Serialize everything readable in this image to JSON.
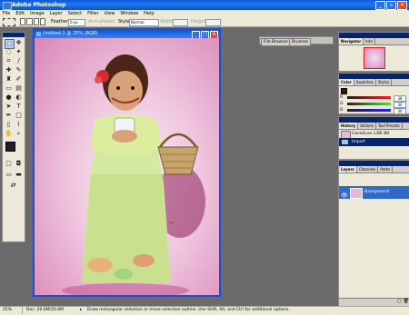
{
  "app": {
    "title": "Adobe Photoshop"
  },
  "menu": [
    "File",
    "Edit",
    "Image",
    "Layer",
    "Select",
    "Filter",
    "View",
    "Window",
    "Help"
  ],
  "options": {
    "feather_label": "Feather:",
    "feather_value": "0 px",
    "antialiased_label": "Anti-aliased",
    "style_label": "Style:",
    "style_value": "Normal",
    "width_label": "Width:",
    "height_label": "Height:"
  },
  "palette_well": {
    "tabs": [
      "File Browser",
      "Brushes"
    ]
  },
  "document": {
    "title": "Untitled-1 @ 25% (RGB)"
  },
  "navigator": {
    "tabs": [
      "Navigator",
      "Info"
    ]
  },
  "color": {
    "tabs": [
      "Color",
      "Swatches",
      "Styles"
    ],
    "channels": [
      {
        "label": "R",
        "value": "38"
      },
      {
        "label": "G",
        "value": "30"
      },
      {
        "label": "B",
        "value": "30"
      }
    ],
    "foreground": "#2a1a1c"
  },
  "history": {
    "tabs": [
      "History",
      "Actions",
      "Tool Presets"
    ],
    "items": [
      "CaneScan LiDE 80",
      "Import"
    ]
  },
  "layers": {
    "tabs": [
      "Layers",
      "Channels",
      "Paths"
    ],
    "items": [
      {
        "name": "Background"
      }
    ]
  },
  "status": {
    "zoom": "25%",
    "doc_size": "Doc: 20.6M/20.6M",
    "hint": "Draw rectangular selection or move selection outline. Use Shift, Alt, and Ctrl for additional options."
  }
}
